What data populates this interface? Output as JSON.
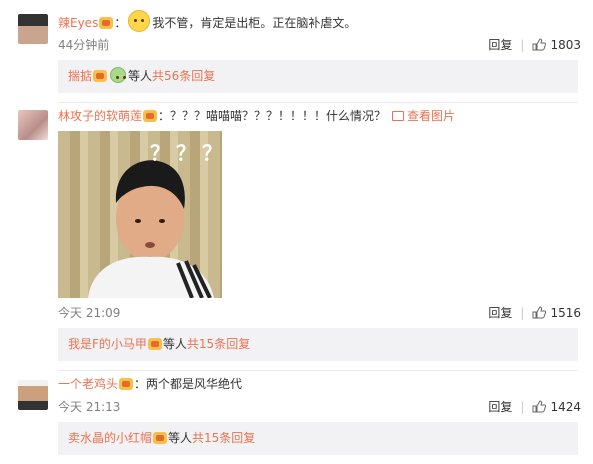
{
  "comments": [
    {
      "username": "辣Eyes",
      "colon": "：",
      "text": "我不管，肯定是出柜。正在脑补虐文。",
      "time": "44分钟前",
      "reply_label": "回复",
      "like_count": "1803",
      "replies": {
        "prefix_name": "揣掂",
        "suffix": "等人",
        "count_text": "共56条回复"
      }
    },
    {
      "username": "林攻子的软萌莲",
      "colon": "：",
      "text": "？？？喵喵喵？？？！！！！什么情况？",
      "pic_link": "查看图片",
      "image_overlay": "？？？",
      "time": "今天 21:09",
      "reply_label": "回复",
      "like_count": "1516",
      "replies": {
        "prefix_name": "我是F的小马甲",
        "suffix": "等人",
        "count_text": "共15条回复"
      }
    },
    {
      "username": "一个老鸡头",
      "colon": "：",
      "text": "两个都是风华绝代",
      "time": "今天 21:13",
      "reply_label": "回复",
      "like_count": "1424",
      "replies": {
        "prefix_name": "卖水晶的小红帽",
        "suffix": "等人",
        "count_text": "共15条回复"
      }
    }
  ],
  "colors": {
    "accent": "#eb7350",
    "reply_bg": "#f2f2f5",
    "meta": "#808080"
  }
}
